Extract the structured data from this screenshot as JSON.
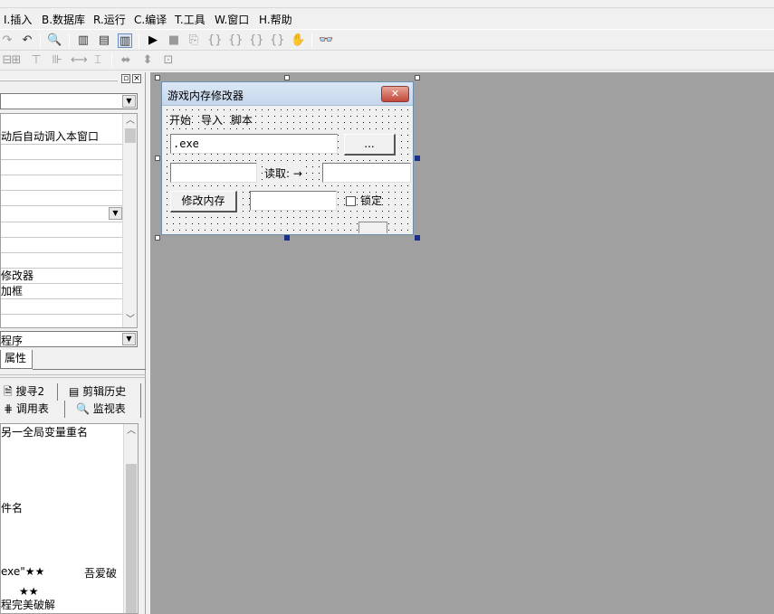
{
  "menu": {
    "items": [
      {
        "label": "I.插入"
      },
      {
        "label": "B.数据库"
      },
      {
        "label": "R.运行"
      },
      {
        "label": "C.编译"
      },
      {
        "label": "T.工具"
      },
      {
        "label": "W.窗口"
      },
      {
        "label": "H.帮助"
      }
    ]
  },
  "toolbar": {
    "icons": [
      "redo-icon",
      "undo-icon",
      "find-icon",
      "layout-icon",
      "layout2-icon",
      "layout3-icon",
      "run-icon",
      "stop-icon",
      "step-icon",
      "step-into-icon",
      "step-over-icon",
      "step-out-icon",
      "run-to-cursor-icon",
      "hand-icon",
      "binoculars-icon"
    ]
  },
  "left_panel": {
    "property_rows": [
      "动后自动调入本窗口",
      "",
      "",
      "",
      "",
      "",
      "",
      "",
      "修改器",
      "加框"
    ],
    "bottom_combo": "程序",
    "prop_tab": "属性",
    "tabs_row1": [
      {
        "icon": "search-icon",
        "label": "搜寻2"
      },
      {
        "icon": "clipboard-icon",
        "label": "剪辑历史"
      }
    ],
    "tabs_row2": [
      {
        "icon": "call-table-icon",
        "label": "调用表"
      },
      {
        "icon": "magnifier-icon",
        "label": "监视表"
      }
    ],
    "output_lines": [
      "另一全局变量重名",
      "件名",
      "exe\"★★",
      "吾爱破",
      "★★",
      "程完美破解"
    ]
  },
  "form": {
    "title": "游戏内存修改器",
    "close_label": "✕",
    "menus": [
      "开始",
      "导入",
      "脚本"
    ],
    "exe_input": ".exe",
    "browse_button": "...",
    "read_label": "读取: →",
    "modify_button": "修改内存",
    "lock_label": "锁定"
  },
  "colors": {
    "design_bg": "#a0a0a0",
    "form_titlebar": "#c6d7ec",
    "close_button": "#c2473a"
  }
}
